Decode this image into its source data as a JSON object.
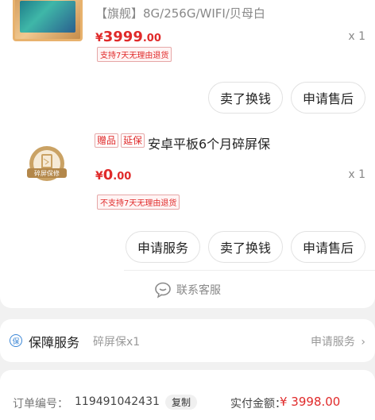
{
  "product1": {
    "spec": "【旗舰】8G/256G/WIFI/贝母白",
    "price_currency": "¥",
    "price_int": "3999",
    "price_dec": ".00",
    "quantity": "x 1",
    "return_tag": "支持7天无理由退货"
  },
  "buttons1": {
    "sell": "卖了换钱",
    "after_sale": "申请售后"
  },
  "product2": {
    "gift_label": "赠品",
    "extend_label": "延保",
    "title": "安卓平板6个月碎屏保",
    "badge_text": "碎屏保修",
    "price_currency": "¥",
    "price_int": "0",
    "price_dec": ".00",
    "quantity": "x 1",
    "return_tag": "不支持7天无理由退货"
  },
  "buttons2": {
    "service": "申请服务",
    "sell": "卖了换钱",
    "after_sale": "申请售后"
  },
  "contact": {
    "label": "联系客服"
  },
  "service": {
    "icon_char": "保",
    "label": "保障服务",
    "value": "碎屏保x1",
    "link": "申请服务",
    "chevron": "›"
  },
  "order": {
    "number_label": "订单编号：",
    "number": "119491042431",
    "copy": "复制",
    "paid_label": "实付金额：",
    "paid_value": "¥ 3998.00"
  },
  "colors": {
    "price": "#e02a2a",
    "accent_blue": "#3a86d6"
  }
}
